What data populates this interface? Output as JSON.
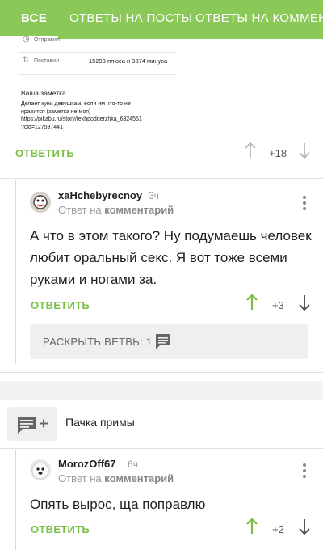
{
  "tabs": [
    {
      "label": "ВСЕ",
      "active": true
    },
    {
      "label": "ОТВЕТЫ НА ПОСТЫ",
      "active": false
    },
    {
      "label": "ОТВЕТЫ НА КОММЕНТАРИИ",
      "active": false
    }
  ],
  "screenshot": {
    "rows": [
      {
        "label": "Отправил",
        "value": ""
      },
      {
        "label": "Поставил",
        "value": "15293 плюса и 3374 минуса"
      }
    ],
    "note_title": "Ваша заметка",
    "note_text": "Делает куни девушкам, если им что-то не\nнравится (заметка не моя)\nhttps://pikabu.ru/story/tekhpodderzhka_6324551\n?cid=127597441"
  },
  "comment0": {
    "reply_label": "ОТВЕТИТЬ",
    "score": "+18"
  },
  "comment1": {
    "username": "xaHchebyrecnoy",
    "time": "3ч",
    "reply_prefix": "Ответ на",
    "reply_target": "комментарий",
    "text": "А что в этом такого? Ну подумаешь человек любит оральный секс. Я вот тоже всеми руками и ногами за.",
    "reply_label": "ОТВЕТИТЬ",
    "score": "+3",
    "expand_label": "РАСКРЫТЬ ВЕТВЬ: 1"
  },
  "post": {
    "title": "Пачка примы"
  },
  "comment2": {
    "username": "MorozOff67",
    "time": "6ч",
    "reply_prefix": "Ответ на",
    "reply_target": "комментарий",
    "text": "Опять вырос, ща поправлю",
    "reply_label": "ОТВЕТИТЬ",
    "score": "+2"
  },
  "colors": {
    "accent": "#8ac858",
    "reply": "#7ac043",
    "upvote_active": "#7ac043",
    "vote_inactive": "#bbbbbb"
  },
  "icons": [
    "arrow-up-icon",
    "arrow-down-icon",
    "more-vertical-icon",
    "comment-icon",
    "add-comment-icon"
  ]
}
